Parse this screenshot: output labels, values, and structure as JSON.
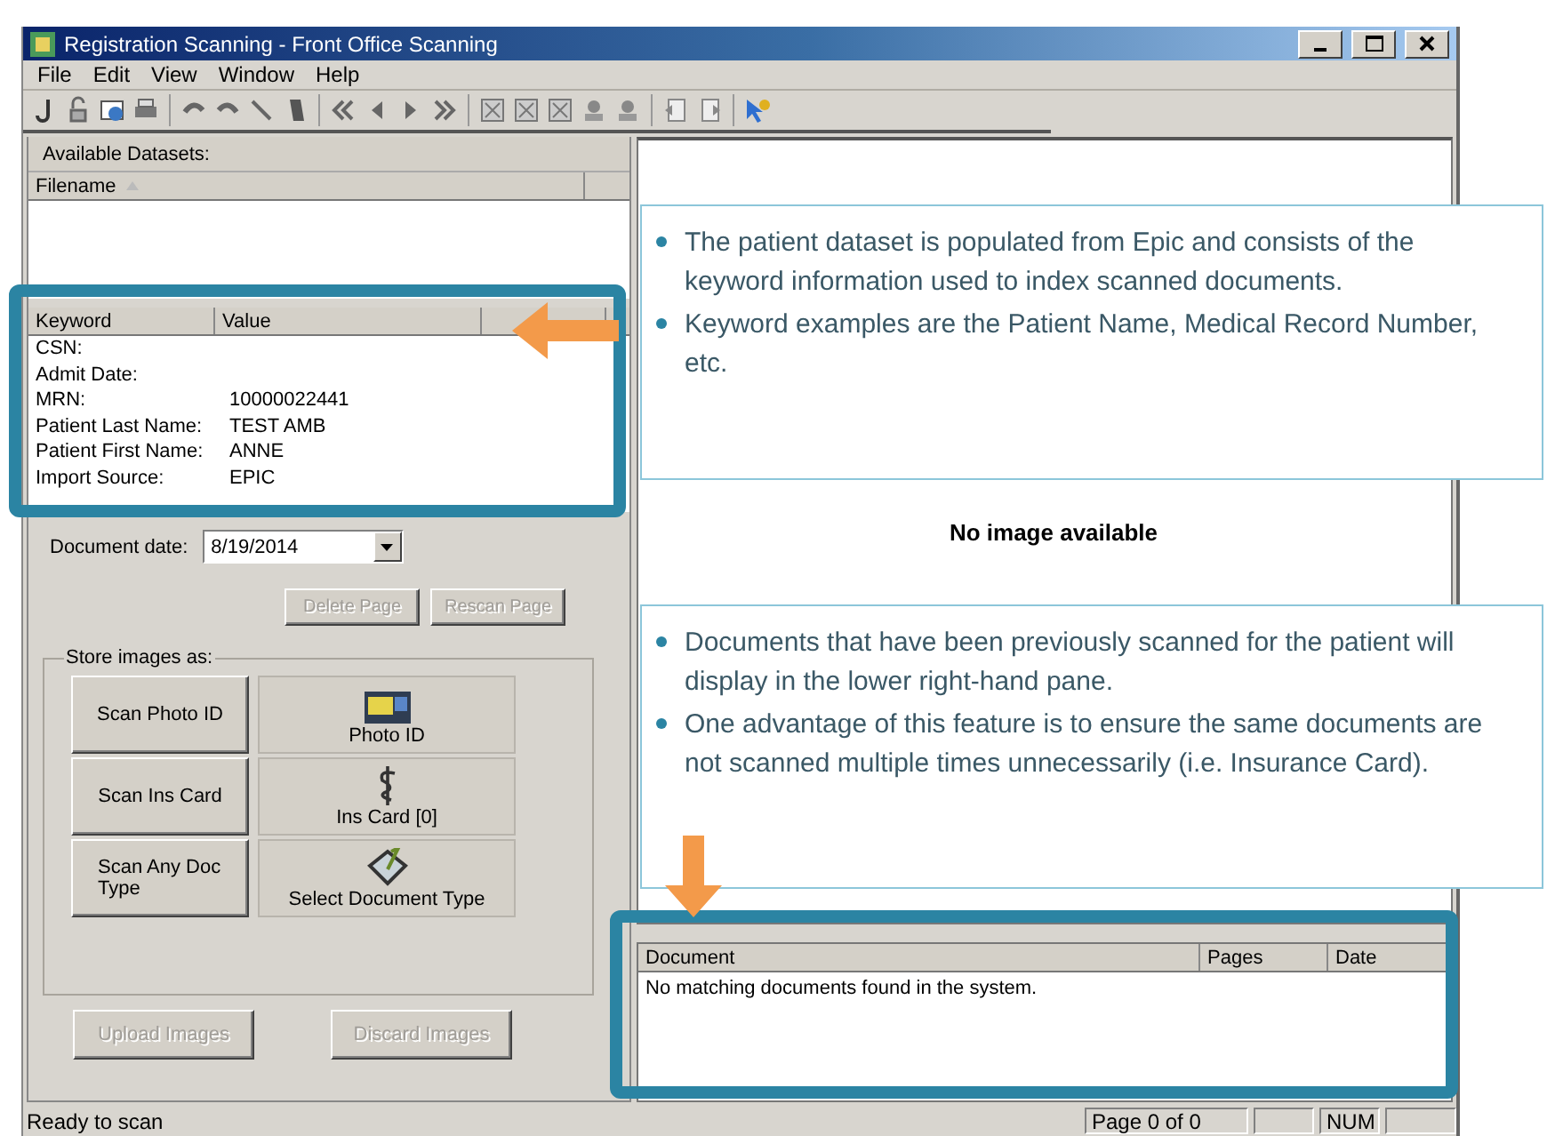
{
  "window": {
    "title": "Registration Scanning - Front Office Scanning"
  },
  "menu": [
    "File",
    "Edit",
    "View",
    "Window",
    "Help"
  ],
  "datasets": {
    "title": "Available Datasets:",
    "columns": [
      "Filename"
    ]
  },
  "keywords": {
    "columns": [
      "Keyword",
      "Value"
    ],
    "rows": [
      {
        "keyword": "CSN:",
        "value": ""
      },
      {
        "keyword": "Admit Date:",
        "value": ""
      },
      {
        "keyword": "MRN:",
        "value": "10000022441"
      },
      {
        "keyword": "Patient Last Name:",
        "value": "TEST AMB"
      },
      {
        "keyword": "Patient First Name:",
        "value": "ANNE"
      },
      {
        "keyword": "Import Source:",
        "value": "EPIC"
      }
    ]
  },
  "document_date": {
    "label": "Document date:",
    "value": "8/19/2014"
  },
  "page_buttons": [
    {
      "label": "Delete Page",
      "disabled": true
    },
    {
      "label": "Rescan Page",
      "disabled": true
    }
  ],
  "store_group": {
    "title": "Store images as:",
    "rows": [
      {
        "scan_label": "Scan Photo ID",
        "type_label": "Photo ID",
        "kind": "photo"
      },
      {
        "scan_label": "Scan Ins Card",
        "type_label": "Ins Card  [0]",
        "kind": "card"
      },
      {
        "scan_label": "Scan Any Doc Type",
        "type_label": "Select Document Type",
        "kind": "doc"
      }
    ]
  },
  "bottom_buttons": [
    {
      "label": "Upload Images",
      "disabled": true
    },
    {
      "label": "Discard Images",
      "disabled": true
    }
  ],
  "image_pane": {
    "message": "No image available"
  },
  "documents": {
    "columns": [
      "Document",
      "Pages",
      "Date"
    ],
    "message": "No matching documents found in the system."
  },
  "status_bar": {
    "message": "Ready to scan",
    "page": "Page 0  of  0",
    "indicator": "NUM"
  },
  "callouts": [
    {
      "bullets": [
        "The patient dataset is populated from Epic and consists of the keyword information used to index scanned documents.",
        "Keyword examples are the Patient Name, Medical Record Number, etc."
      ]
    },
    {
      "bullets": [
        "Documents that have been previously scanned for the patient will display in the lower right-hand pane.",
        "One advantage of this feature is to ensure the same documents are not scanned multiple times unnecessarily (i.e. Insurance Card)."
      ]
    }
  ]
}
